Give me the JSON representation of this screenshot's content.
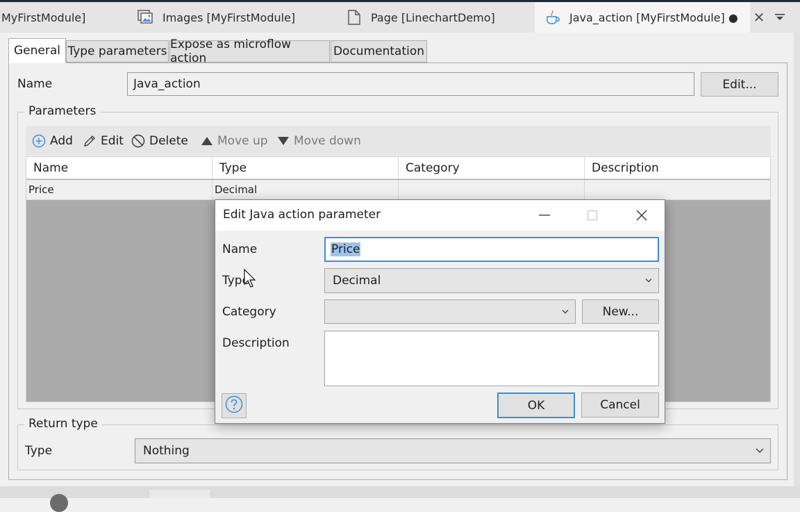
{
  "doc_tabs": [
    {
      "label": "MyFirstModule]",
      "icon": "none"
    },
    {
      "label": "Images [MyFirstModule]",
      "icon": "images-icon"
    },
    {
      "label": "Page [LinechartDemo]",
      "icon": "page-icon"
    },
    {
      "label": "Java_action [MyFirstModule] ●",
      "icon": "java-cup-icon",
      "active": true
    }
  ],
  "property_tabs": [
    {
      "label": "General",
      "active": true
    },
    {
      "label": "Type parameters"
    },
    {
      "label": "Expose as microflow action"
    },
    {
      "label": "Documentation"
    }
  ],
  "general": {
    "name_label": "Name",
    "name_value": "Java_action",
    "edit_button": "Edit..."
  },
  "parameters": {
    "group_title": "Parameters",
    "toolbar": {
      "add": "Add",
      "edit": "Edit",
      "delete": "Delete",
      "move_up": "Move up",
      "move_down": "Move down"
    },
    "columns": [
      "Name",
      "Type",
      "Category",
      "Description"
    ],
    "rows": [
      {
        "name": "Price",
        "type": "Decimal",
        "category": "",
        "description": ""
      }
    ]
  },
  "return_type": {
    "group_title": "Return type",
    "type_label": "Type",
    "type_value": "Nothing"
  },
  "dialog": {
    "title": "Edit Java action parameter",
    "name_label": "Name",
    "name_value": "Price",
    "type_label": "Type",
    "type_value": "Decimal",
    "category_label": "Category",
    "category_value": "",
    "new_button": "New...",
    "description_label": "Description",
    "description_value": "",
    "ok_button": "OK",
    "cancel_button": "Cancel"
  },
  "colors": {
    "accent": "#3b8edb",
    "selection": "#9cc3ec",
    "grid_empty": "#ababab"
  }
}
